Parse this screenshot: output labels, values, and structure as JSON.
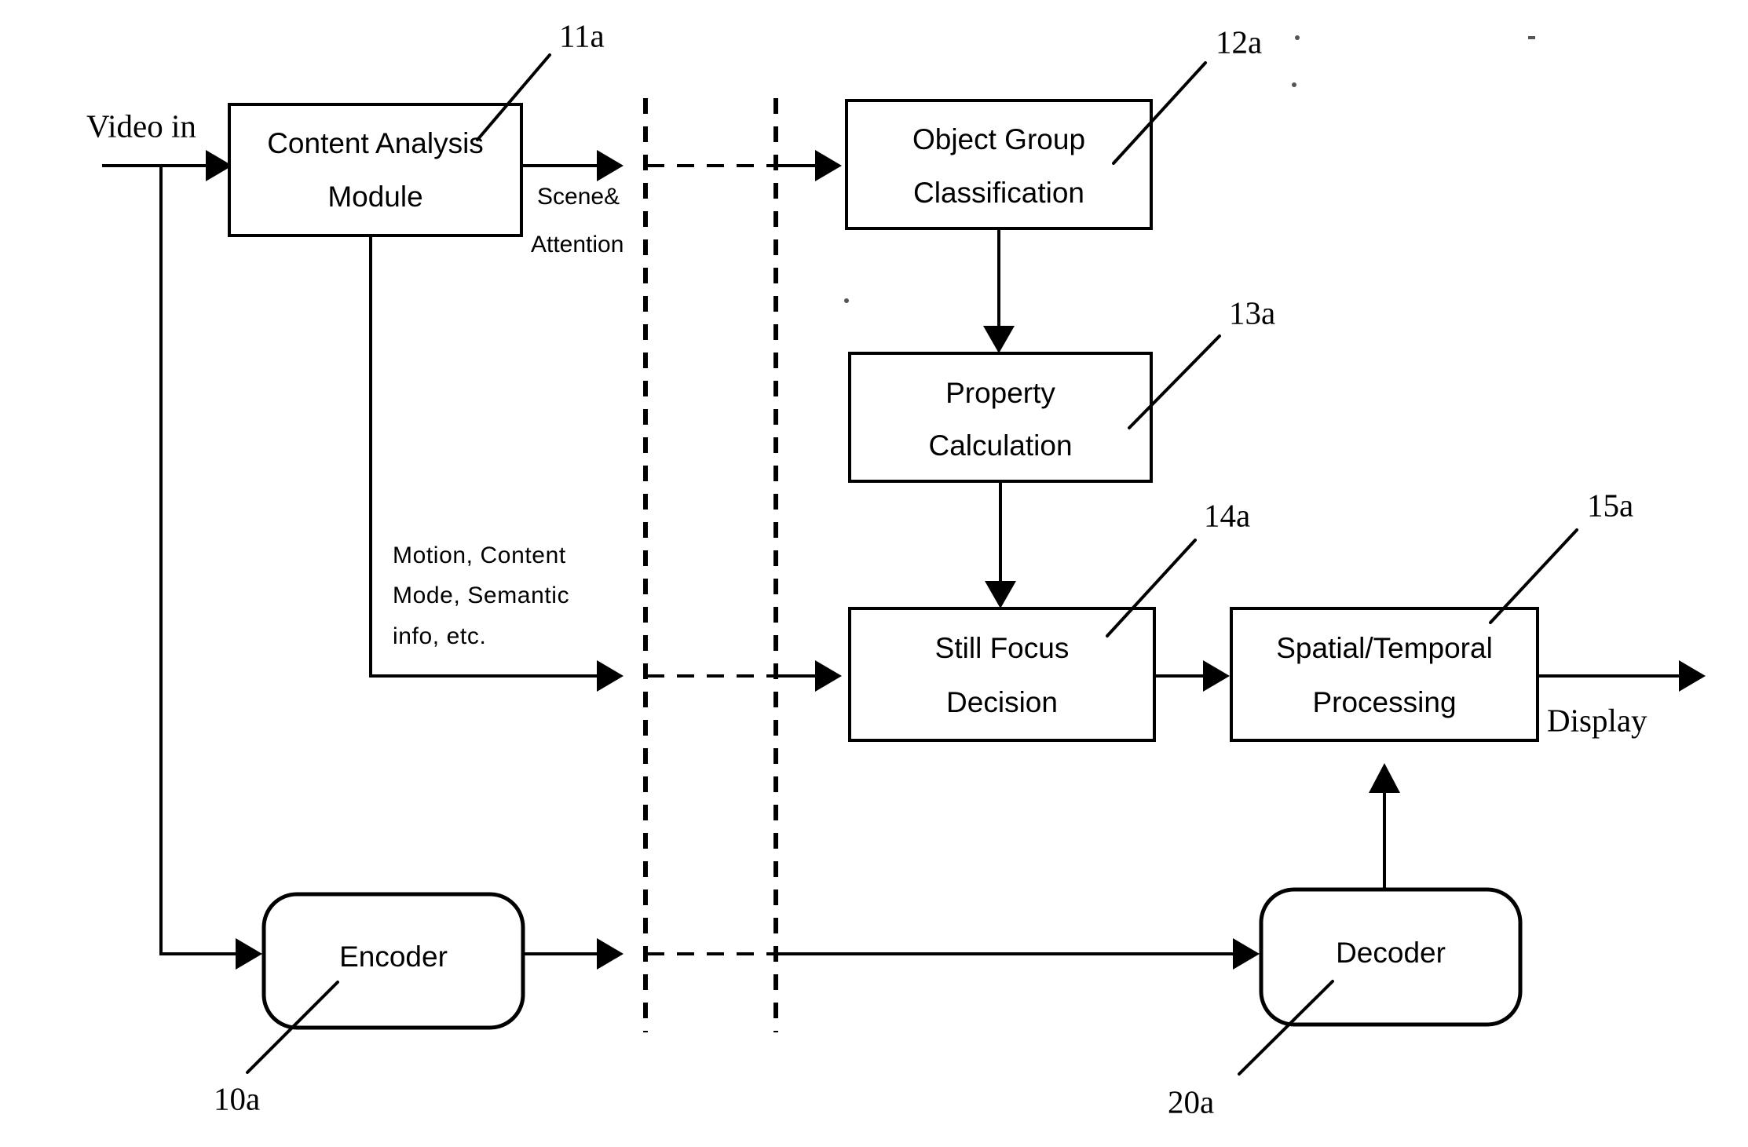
{
  "figure": {
    "type": "patent-block-diagram",
    "background_color": "#ffffff",
    "line_color": "#000000"
  },
  "blocks": [
    {
      "id": "content-analysis-module",
      "label_line1": "Content Analysis",
      "label_line2": "Module",
      "shape": "rect"
    },
    {
      "id": "object-group-classification",
      "label_line1": "Object Group",
      "label_line2": "Classification",
      "shape": "rect"
    },
    {
      "id": "property-calculation",
      "label_line1": "Property",
      "label_line2": "Calculation",
      "shape": "rect"
    },
    {
      "id": "still-focus-decision",
      "label_line1": "Still Focus",
      "label_line2": "Decision",
      "shape": "rect"
    },
    {
      "id": "spatial-temporal-processing",
      "label_line1": "Spatial/Temporal",
      "label_line2": "Processing",
      "shape": "rect"
    },
    {
      "id": "encoder",
      "label_line1": "Encoder",
      "label_line2": "",
      "shape": "rounded-rect"
    },
    {
      "id": "decoder",
      "label_line1": "Decoder",
      "label_line2": "",
      "shape": "rounded-rect"
    }
  ],
  "reference_numerals": [
    {
      "id": "ref-10a",
      "text": "10a",
      "points_to": "encoder"
    },
    {
      "id": "ref-11a",
      "text": "11a",
      "points_to": "content-analysis-module"
    },
    {
      "id": "ref-12a",
      "text": "12a",
      "points_to": "object-group-classification"
    },
    {
      "id": "ref-13a",
      "text": "13a",
      "points_to": "property-calculation"
    },
    {
      "id": "ref-14a",
      "text": "14a",
      "points_to": "still-focus-decision"
    },
    {
      "id": "ref-15a",
      "text": "15a",
      "points_to": "spatial-temporal-processing"
    },
    {
      "id": "ref-20a",
      "text": "20a",
      "points_to": "decoder"
    }
  ],
  "io_labels": {
    "input": "Video in",
    "output": "Display"
  },
  "signal_labels": {
    "scene_line1": "Scene&",
    "scene_line2": "Attention",
    "metadata_line1": "Motion,  Content",
    "metadata_line2": "Mode,  Semantic",
    "metadata_line3": "info, etc."
  }
}
